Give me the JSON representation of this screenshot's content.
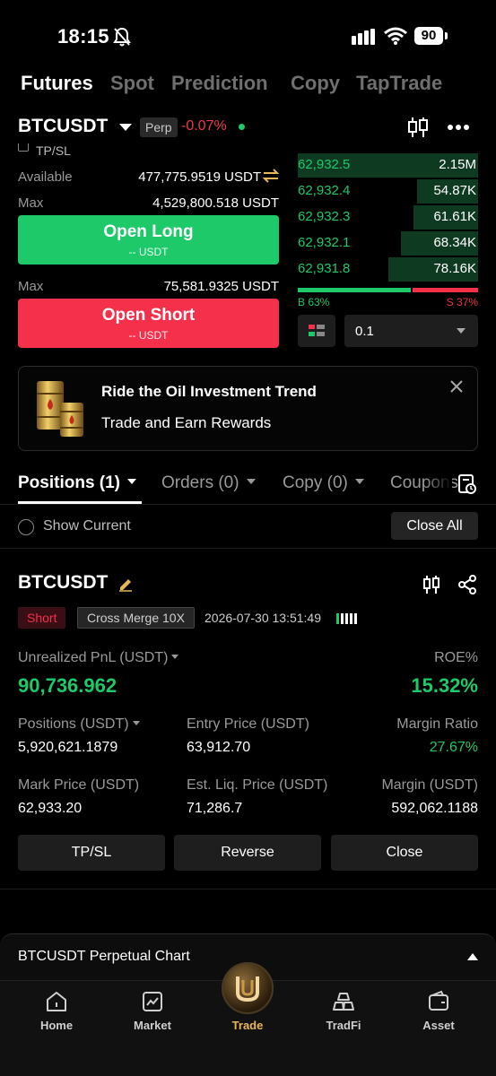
{
  "status_bar": {
    "time": "18:15",
    "battery": "90"
  },
  "top_tabs": [
    "Futures",
    "Spot",
    "Prediction",
    "Copy",
    "TapTrade"
  ],
  "pair": {
    "name": "BTCUSDT",
    "badge": "Perp",
    "change": "-0.07%"
  },
  "form": {
    "tpsl_label": "TP/SL",
    "available_label": "Available",
    "available_value": "477,775.9519 USDT",
    "max_long_label": "Max",
    "max_long_value": "4,529,800.518 USDT",
    "long_label": "Open Long",
    "long_sub": "-- USDT",
    "max_short_label": "Max",
    "max_short_value": "75,581.9325 USDT",
    "short_label": "Open Short",
    "short_sub": "-- USDT"
  },
  "orderbook": {
    "rows": [
      {
        "price": "62,932.5",
        "qty": "2.15M",
        "depth": 1.0
      },
      {
        "price": "62,932.4",
        "qty": "54.87K",
        "depth": 0.34
      },
      {
        "price": "62,932.3",
        "qty": "61.61K",
        "depth": 0.36
      },
      {
        "price": "62,932.1",
        "qty": "68.34K",
        "depth": 0.43
      },
      {
        "price": "62,931.8",
        "qty": "78.16K",
        "depth": 0.5
      }
    ],
    "buy_ratio": 0.63,
    "buy_label": "B 63%",
    "sell_label": "S 37%",
    "depth_value": "0.1"
  },
  "promo": {
    "title": "Ride the Oil Investment Trend",
    "subtitle": "Trade and Earn Rewards"
  },
  "position_tabs": [
    "Positions (1)",
    "Orders (0)",
    "Copy (0)",
    "Coupons"
  ],
  "filters": {
    "show_current": "Show Current",
    "close_all": "Close All"
  },
  "position": {
    "symbol": "BTCUSDT",
    "side": "Short",
    "mode": "Cross Merge 10X",
    "time": "2026-07-30 13:51:49",
    "pnl_label": "Unrealized PnL (USDT)",
    "pnl_value": "90,736.962",
    "roe_label": "ROE%",
    "roe_value": "15.32%",
    "positions_label": "Positions (USDT)",
    "positions_value": "5,920,621.1879",
    "entry_label": "Entry Price (USDT)",
    "entry_value": "63,912.70",
    "margin_ratio_label": "Margin Ratio",
    "margin_ratio_value": "27.67%",
    "mark_label": "Mark Price (USDT)",
    "mark_value": "62,933.20",
    "liq_label": "Est. Liq. Price (USDT)",
    "liq_value": "71,286.7",
    "margin_label": "Margin (USDT)",
    "margin_value": "592,062.1188",
    "actions": [
      "TP/SL",
      "Reverse",
      "Close"
    ]
  },
  "chart_bar": {
    "label": "BTCUSDT Perpetual Chart"
  },
  "bottom_nav": [
    "Home",
    "Market",
    "Trade",
    "TradFi",
    "Asset"
  ],
  "colors": {
    "green": "#1ec96a",
    "red": "#f5304b",
    "gold": "#e8b75a"
  }
}
